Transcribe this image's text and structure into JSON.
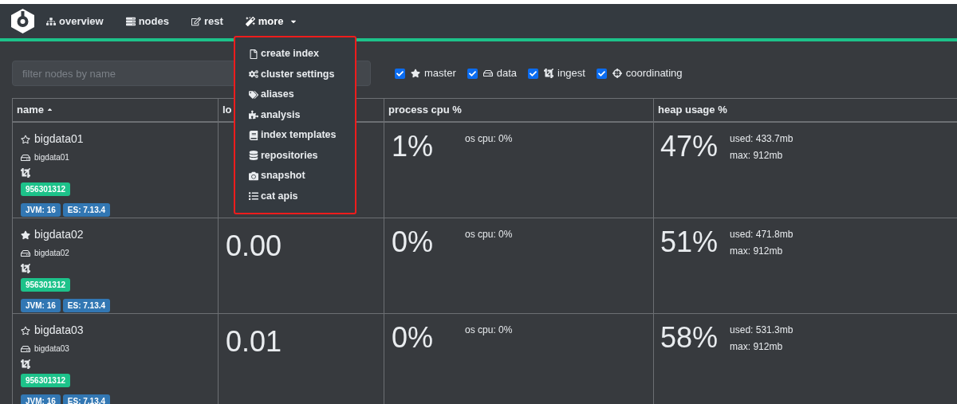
{
  "navbar": {
    "items": [
      {
        "label": "overview",
        "expanded": false
      },
      {
        "label": "nodes",
        "expanded": false
      },
      {
        "label": "rest",
        "expanded": false
      },
      {
        "label": "more",
        "expanded": true
      }
    ]
  },
  "more_menu": {
    "items": [
      {
        "label": "create index"
      },
      {
        "label": "cluster settings"
      },
      {
        "label": "aliases"
      },
      {
        "label": "analysis"
      },
      {
        "label": "index templates"
      },
      {
        "label": "repositories"
      },
      {
        "label": "snapshot"
      },
      {
        "label": "cat apis"
      }
    ]
  },
  "filter": {
    "placeholder": "filter nodes by name"
  },
  "role_filters": [
    {
      "label": "master",
      "checked": true
    },
    {
      "label": "data",
      "checked": true
    },
    {
      "label": "ingest",
      "checked": true
    },
    {
      "label": "coordinating",
      "checked": true
    }
  ],
  "table": {
    "columns": [
      {
        "label": "name",
        "sorted": true
      },
      {
        "label": "lo"
      },
      {
        "label": "process cpu %"
      },
      {
        "label": "heap usage %"
      }
    ],
    "rows": [
      {
        "name": "bigdata01",
        "master": false,
        "host": "bigdata01",
        "badge": "956301312",
        "jvm": "JVM: 16",
        "es": "ES: 7.13.4",
        "cpu": "1%",
        "os_cpu": "os cpu: 0%",
        "heap": "47%",
        "used": "used: 433.7mb",
        "max": "max: 912mb"
      },
      {
        "name": "bigdata02",
        "master": true,
        "host": "bigdata02",
        "badge": "956301312",
        "jvm": "JVM: 16",
        "es": "ES: 7.13.4",
        "load": "0.00",
        "cpu": "0%",
        "os_cpu": "os cpu: 0%",
        "heap": "51%",
        "used": "used: 471.8mb",
        "max": "max: 912mb"
      },
      {
        "name": "bigdata03",
        "master": false,
        "host": "bigdata03",
        "badge": "956301312",
        "jvm": "JVM: 16",
        "es": "ES: 7.13.4",
        "load": "0.01",
        "cpu": "0%",
        "os_cpu": "os cpu: 0%",
        "heap": "58%",
        "used": "used: 531.3mb",
        "max": "max: 912mb"
      }
    ]
  }
}
